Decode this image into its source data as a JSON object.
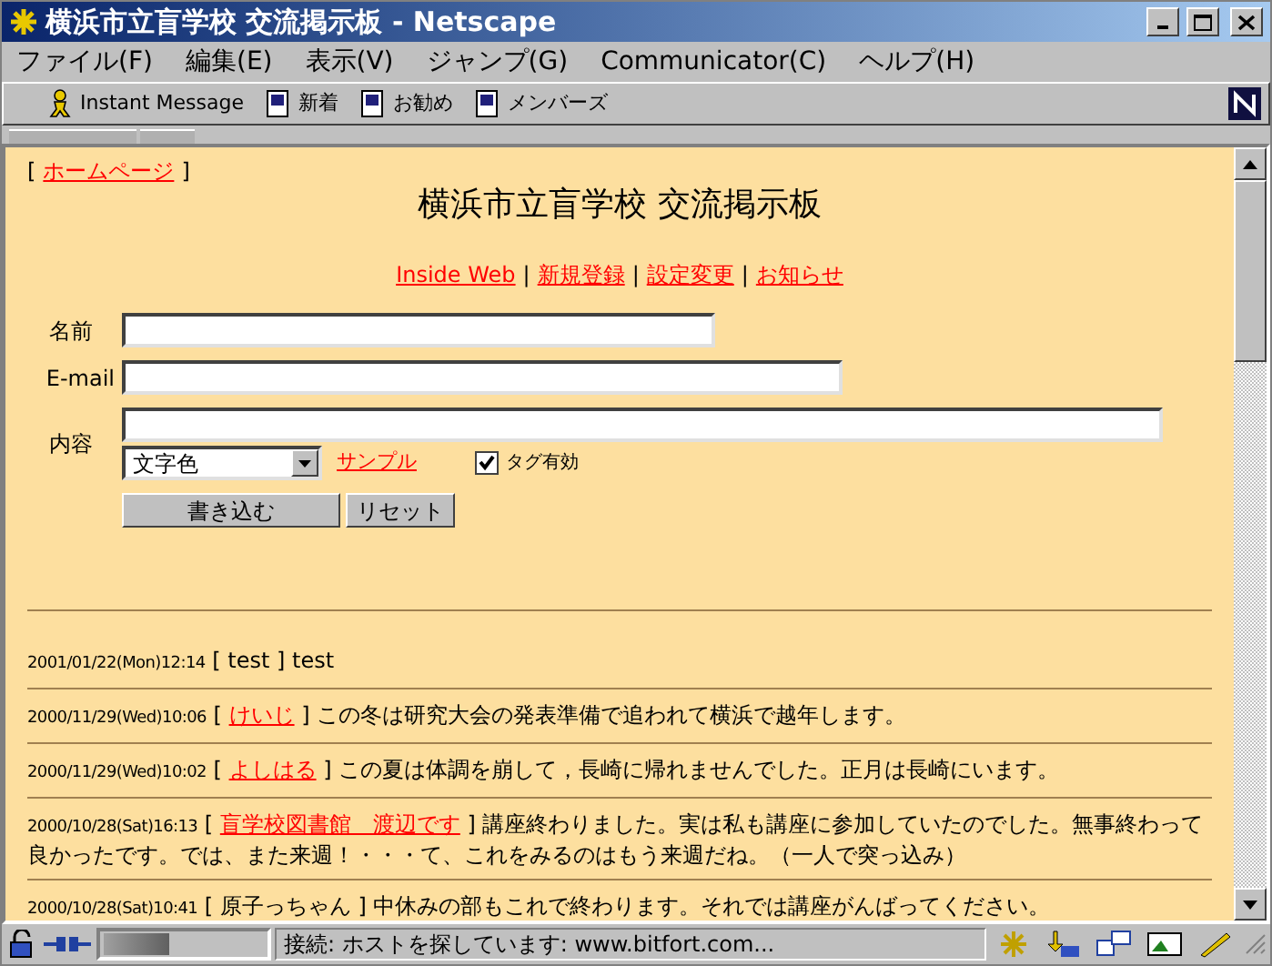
{
  "window": {
    "title": "横浜市立盲学校 交流掲示板 - Netscape"
  },
  "menu": [
    "ファイル(F)",
    "編集(E)",
    "表示(V)",
    "ジャンプ(G)",
    "Communicator(C)",
    "ヘルプ(H)"
  ],
  "toolbar": [
    {
      "label": "Instant Message",
      "kind": "person"
    },
    {
      "label": "新着",
      "kind": "page"
    },
    {
      "label": "お勧め",
      "kind": "page"
    },
    {
      "label": "メンバーズ",
      "kind": "page"
    }
  ],
  "page": {
    "home_open": "[",
    "home_link": "ホームページ",
    "home_close": "]",
    "heading": "横浜市立盲学校 交流掲示板",
    "nav_links": [
      {
        "label": "Inside Web"
      },
      {
        "separator": "|",
        "label": "新規登録"
      },
      {
        "separator": "|",
        "label": "設定変更"
      },
      {
        "separator": "|",
        "label": "お知らせ"
      }
    ],
    "form": {
      "name_label": "名前",
      "email_label": "E-mail",
      "content_label": "内容",
      "color_select": "文字色",
      "sample_link": "サンプル",
      "tag_checkbox": {
        "label": "タグ有効",
        "checked": true
      },
      "submit": "書き込む",
      "reset": "リセット"
    },
    "posts": [
      {
        "date": "2001/01/22(Mon)12:14",
        "open": "[",
        "author": "test",
        "close": "]",
        "linked": false,
        "message": "test"
      },
      {
        "date": "2000/11/29(Wed)10:06",
        "open": "[",
        "author": "けいじ",
        "close": "]",
        "linked": true,
        "message": "この冬は研究大会の発表準備で追われて横浜で越年します。"
      },
      {
        "date": "2000/11/29(Wed)10:02",
        "open": "[",
        "author": "よしはる",
        "close": "]",
        "linked": true,
        "message": "この夏は体調を崩して，長崎に帰れませんでした。正月は長崎にいます。"
      },
      {
        "date": "2000/10/28(Sat)16:13",
        "open": "[",
        "author": "盲学校図書館　渡辺です",
        "close": "]",
        "linked": true,
        "message": "講座終わりました。実は私も講座に参加していたのでした。無事終わって良かったです。では、また来週！・・・て、これをみるのはもう来週だね。（一人で突っ込み）"
      },
      {
        "date": "2000/10/28(Sat)10:41",
        "open": "[",
        "author": "原子っちゃん",
        "close": "]",
        "linked": false,
        "message": "中休みの部もこれで終わります。それでは講座がんばってください。"
      }
    ]
  },
  "status_bar": {
    "text": "接続: ホストを探しています: www.bitfort.com..."
  }
}
